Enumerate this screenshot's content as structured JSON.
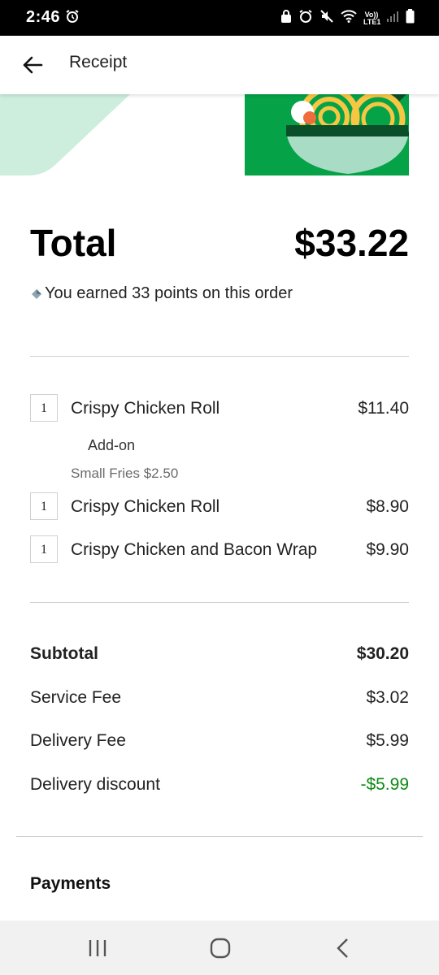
{
  "status": {
    "time": "2:46",
    "network": "Vo)) LTE1"
  },
  "header": {
    "title": "Receipt"
  },
  "summary": {
    "total_label": "Total",
    "total_value": "$33.22",
    "points_text": "You earned 33 points on this order"
  },
  "items": [
    {
      "qty": "1",
      "name": "Crispy Chicken Roll",
      "price": "$11.40"
    },
    {
      "qty": "1",
      "name": "Crispy Chicken Roll",
      "price": "$8.90"
    },
    {
      "qty": "1",
      "name": "Crispy Chicken and Bacon Wrap",
      "price": "$9.90"
    }
  ],
  "addon": {
    "label": "Add-on",
    "detail": "Small Fries $2.50"
  },
  "costs": {
    "subtotal_label": "Subtotal",
    "subtotal_value": "$30.20",
    "service_label": "Service Fee",
    "service_value": "$3.02",
    "delivery_label": "Delivery Fee",
    "delivery_value": "$5.99",
    "discount_label": "Delivery discount",
    "discount_value": "-$5.99"
  },
  "payments": {
    "title": "Payments"
  },
  "colors": {
    "brand_green": "#06a248",
    "discount_green": "#0e8a16",
    "bowl_mint": "#a8dcc5"
  }
}
